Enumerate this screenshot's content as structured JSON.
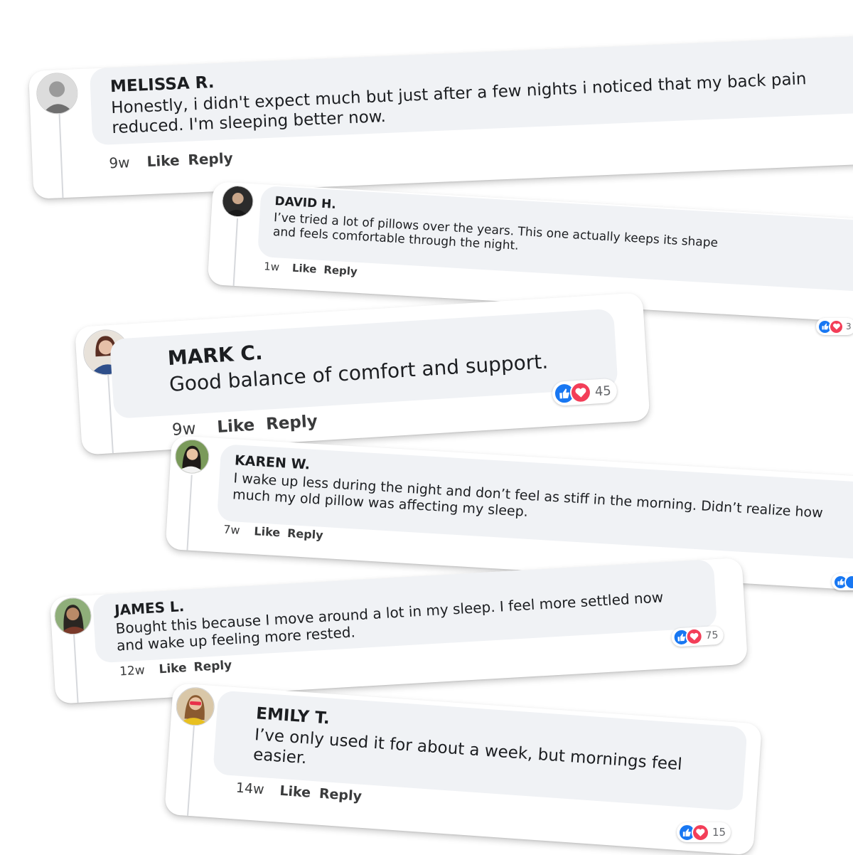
{
  "comments": [
    {
      "name": "Melissa R.",
      "text": "Honestly, i didn't expect much but just after a few nights i noticed that my back pain reduced. I'm sleeping better now.",
      "time": "9w",
      "like": "Like",
      "reply": "Reply",
      "avatar_color": "#8c8c8c"
    },
    {
      "name": "David H.",
      "text": "I’ve tried a lot of pillows over the years. This one actually keeps its shape and feels comfortable through the night.",
      "time": "1w",
      "like": "Like",
      "reply": "Reply",
      "reactions": "3",
      "avatar_color": "#4a4a4a"
    },
    {
      "name": "Mark C.",
      "text": "Good balance of comfort and support.",
      "time": "9w",
      "like": "Like",
      "reply": "Reply",
      "reactions": "45",
      "avatar_color": "#b05a4a"
    },
    {
      "name": "Karen W.",
      "text": "I wake up less during the night and don’t feel as stiff in the morning. Didn’t realize how much my old pillow was affecting my sleep.",
      "time": "7w",
      "like": "Like",
      "reply": "Reply",
      "avatar_color": "#5a8a4a"
    },
    {
      "name": "James L.",
      "text": "Bought this because I move around a lot in my sleep. I feel more settled now and wake up feeling more rested.",
      "time": "12w",
      "like": "Like",
      "reply": "Reply",
      "reactions": "75",
      "avatar_color": "#8a6a50"
    },
    {
      "name": "Emily T.",
      "text": "I’ve only used it for about a week, but mornings feel easier.",
      "time": "14w",
      "like": "Like",
      "reply": "Reply",
      "reactions": "15",
      "avatar_color": "#d4a020"
    }
  ],
  "colors": {
    "like": "#1877f2",
    "love": "#f33e58",
    "bubble": "#f0f2f5"
  },
  "icons": {
    "like": "thumbs-up-icon",
    "love": "heart-icon"
  }
}
